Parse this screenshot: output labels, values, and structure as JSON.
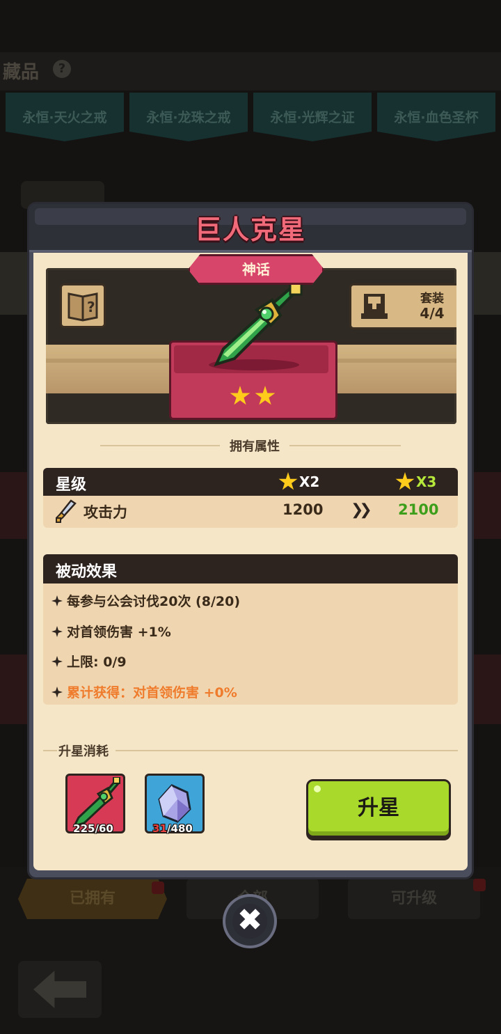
{
  "background": {
    "page_title": "藏品",
    "help_icon": "question-icon",
    "tabs": [
      "永恒·天火之戒",
      "永恒·龙珠之戒",
      "永恒·光辉之证",
      "永恒·血色圣杯"
    ],
    "bottom_buttons": {
      "owned": "已拥有",
      "all": "全部",
      "upgradable": "可升级"
    },
    "back_icon": "back-arrow-icon"
  },
  "dialog": {
    "title": "巨人克星",
    "rarity": "神话",
    "current_stars": 2,
    "set": {
      "label": "套装",
      "value": "4/4"
    },
    "attributes_title": "拥有属性",
    "star_stats": {
      "header_label": "星级",
      "current_multiplier": "X2",
      "next_multiplier": "X3",
      "stat_name": "攻击力",
      "current_value": "1200",
      "next_value": "2100",
      "arrow": "»"
    },
    "passive": {
      "header_label": "被动效果",
      "lines": [
        "每参与公会讨伐20次 (8/20)",
        "对首领伤害 +1%",
        "上限: 0/9",
        "累计获得：对首领伤害 +0%"
      ]
    },
    "cost": {
      "title": "升星消耗",
      "items": [
        {
          "icon": "dagger-icon",
          "have": "225",
          "need": "60"
        },
        {
          "icon": "crystal-icon",
          "have": "31",
          "need": "480"
        }
      ]
    },
    "upgrade_button": "升星",
    "close_icon": "close-icon"
  },
  "colors": {
    "title_pink": "#f06a7a",
    "rarity_pink": "#d7456a",
    "accent_orange": "#ef7b2c",
    "value_green": "#3c9e1a",
    "button_green": "#a9d92a",
    "star_gold": "#ffcc1c",
    "panel_cream": "#f5e6c8"
  }
}
